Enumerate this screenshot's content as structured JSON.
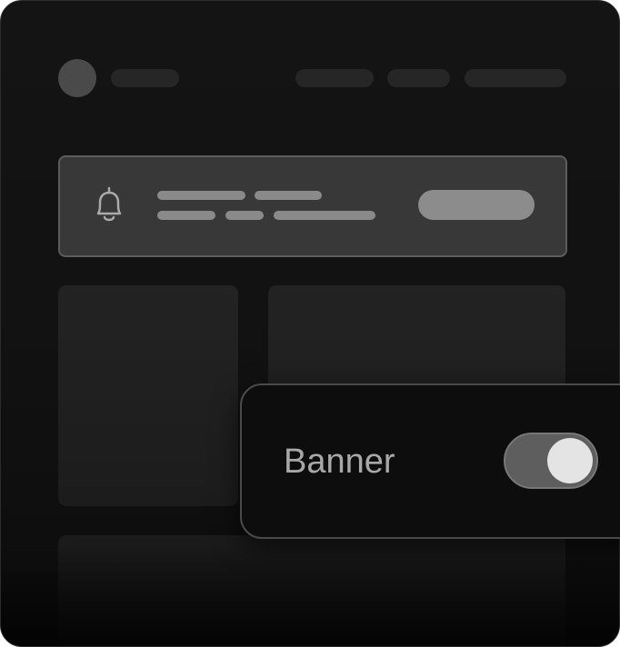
{
  "settings_popover": {
    "banner_label": "Banner",
    "banner_toggle_on": true
  },
  "colors": {
    "background": "#111111",
    "banner_fill": "#383838",
    "toggle_track": "#5e5e5e",
    "toggle_knob": "#e4e4e4",
    "label_text": "#a8a8a8"
  },
  "icons": {
    "banner": "bell-icon"
  }
}
